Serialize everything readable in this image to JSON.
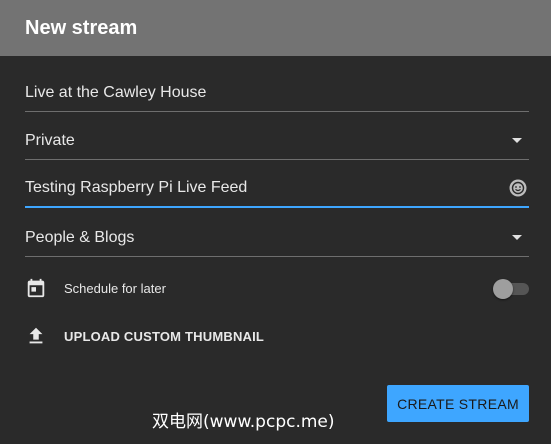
{
  "dialog": {
    "title": "New stream"
  },
  "fields": {
    "title_value": "Live at the Cawley House",
    "visibility_value": "Private",
    "description_value": "Testing Raspberry Pi Live Feed",
    "category_value": "People & Blogs"
  },
  "options": {
    "schedule_label": "Schedule for later",
    "schedule_enabled": false,
    "upload_thumbnail_label": "UPLOAD CUSTOM THUMBNAIL"
  },
  "actions": {
    "create_label": "CREATE STREAM"
  },
  "watermark": {
    "text": "双电网(www.pcpc.me)"
  },
  "colors": {
    "accent": "#3ea6ff",
    "header_bg": "#737373",
    "panel_bg": "#2a2a2a"
  },
  "icons": {
    "visibility_dropdown": "caret-down-icon",
    "description_emoji": "emoji-icon",
    "category_dropdown": "caret-down-icon",
    "schedule": "calendar-icon",
    "upload": "upload-icon"
  }
}
